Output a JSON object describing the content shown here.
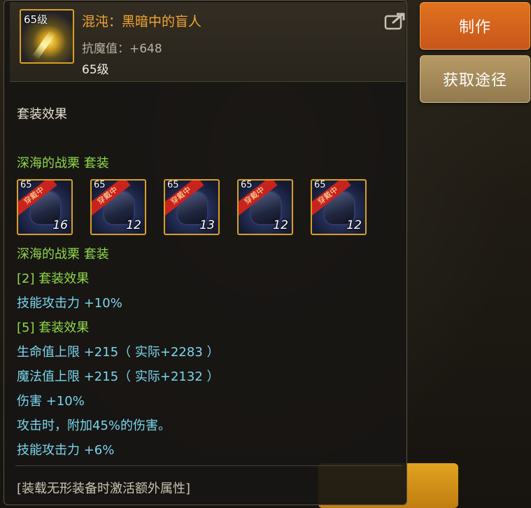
{
  "item": {
    "icon_level": "65级",
    "name": "混沌：黑暗中的盲人",
    "stat": "抗魔值：+648",
    "level": "65级"
  },
  "buttons": {
    "make": "制作",
    "source": "获取途径"
  },
  "set_section": {
    "title": "套装效果",
    "set_name_top": "深海的战栗  套装",
    "slots": [
      {
        "tag": "65",
        "ribbon": "穿戴中",
        "count": "16"
      },
      {
        "tag": "65",
        "ribbon": "穿戴中",
        "count": "12"
      },
      {
        "tag": "65",
        "ribbon": "穿戴中",
        "count": "13"
      },
      {
        "tag": "65",
        "ribbon": "穿戴中",
        "count": "12"
      },
      {
        "tag": "65",
        "ribbon": "穿戴中",
        "count": "12"
      }
    ],
    "set_name_bottom": "深海的战栗  套装",
    "effect2_title": "[2] 套装效果",
    "effect2_lines": [
      "技能攻击力 +10%"
    ],
    "effect5_title": "[5] 套装效果",
    "effect5_lines": [
      "生命值上限 +215（ 实际+2283 ）",
      "魔法值上限 +215（ 实际+2132 ）",
      "伤害 +10%",
      "攻击时，附加45%的伤害。",
      "技能攻击力 +6%"
    ]
  },
  "footer": "[装载无形装备时激活额外属性]",
  "icons": [
    "share-icon"
  ],
  "colors": {
    "name": "#f3a632",
    "set_green": "#8dd84a",
    "effect_cyan": "#7ad6ee",
    "make_button": "#d8621d",
    "source_button": "#a88b5a",
    "frame_gold": "#d9a11f"
  }
}
